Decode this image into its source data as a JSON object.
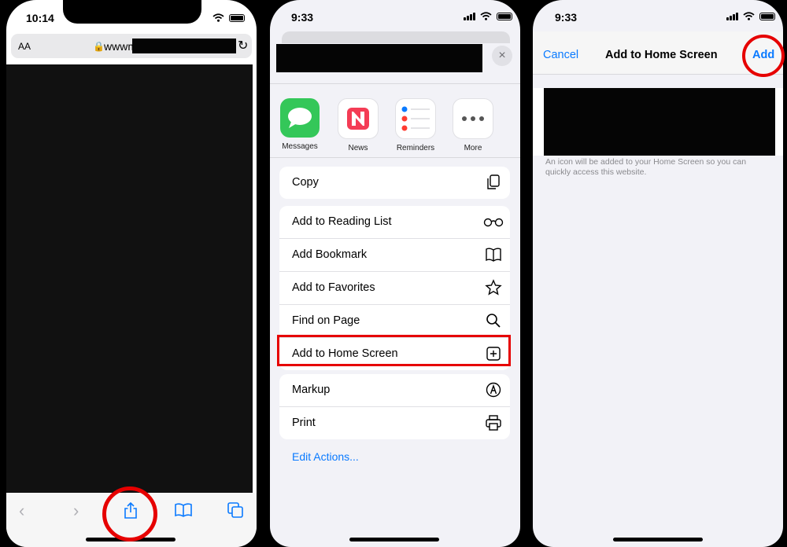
{
  "phone1": {
    "time": "10:14",
    "aa_label": "AA",
    "url_text": "wwwm",
    "toolbar": {
      "back": "‹",
      "forward": "›"
    }
  },
  "phone2": {
    "time": "9:33",
    "close": "×",
    "apps": [
      {
        "label": "Messages"
      },
      {
        "label": "News"
      },
      {
        "label": "Reminders"
      },
      {
        "label": "More"
      }
    ],
    "actions": {
      "copy": "Copy",
      "reading_list": "Add to Reading List",
      "bookmark": "Add Bookmark",
      "favorites": "Add to Favorites",
      "find": "Find on Page",
      "home_screen": "Add to Home Screen",
      "markup": "Markup",
      "print": "Print"
    },
    "edit_actions": "Edit Actions..."
  },
  "phone3": {
    "time": "9:33",
    "cancel": "Cancel",
    "title": "Add to Home Screen",
    "add": "Add",
    "note": "An icon will be added to your Home Screen so you can quickly access this website."
  },
  "colors": {
    "accent": "#0a7aff",
    "highlight": "#e60000"
  }
}
